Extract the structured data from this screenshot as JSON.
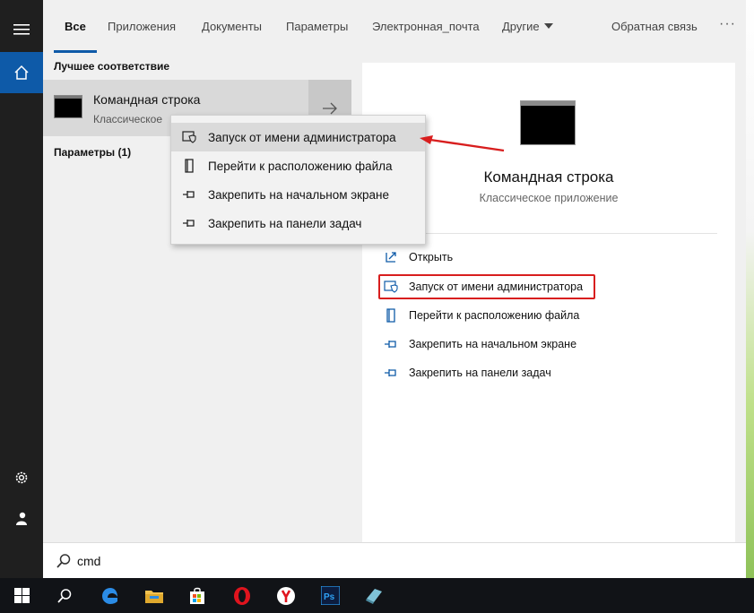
{
  "tabs": [
    {
      "label": "Все"
    },
    {
      "label": "Приложения"
    },
    {
      "label": "Документы"
    },
    {
      "label": "Параметры"
    },
    {
      "label": "Электронная_почта"
    },
    {
      "label": "Другие"
    }
  ],
  "feedback_label": "Обратная связь",
  "more_label": "···",
  "results": {
    "best_match_heading": "Лучшее соответствие",
    "best_title": "Командная строка",
    "best_subtitle": "Классическое",
    "settings_heading": "Параметры (1)"
  },
  "context_menu": [
    {
      "label": "Запуск от имени администратора",
      "icon": "shield-icon"
    },
    {
      "label": "Перейти к расположению файла",
      "icon": "file-location-icon"
    },
    {
      "label": "Закрепить на начальном экране",
      "icon": "pin-icon"
    },
    {
      "label": "Закрепить на панели задач",
      "icon": "pin-icon"
    }
  ],
  "preview": {
    "title": "Командная строка",
    "subtitle": "Классическое приложение",
    "actions": [
      {
        "label": "Открыть",
        "icon": "open-icon"
      },
      {
        "label": "Запуск от имени администратора",
        "icon": "shield-icon"
      },
      {
        "label": "Перейти к расположению файла",
        "icon": "file-location-icon"
      },
      {
        "label": "Закрепить на начальном экране",
        "icon": "pin-icon"
      },
      {
        "label": "Закрепить на панели задач",
        "icon": "pin-icon"
      }
    ]
  },
  "search": {
    "value": "cmd"
  },
  "colors": {
    "accent": "#0e5aa8",
    "annotation": "#d81e1e"
  },
  "taskbar_icons": [
    "windows-start-icon",
    "search-icon",
    "edge-icon",
    "file-explorer-icon",
    "store-icon",
    "opera-icon",
    "yandex-icon",
    "photoshop-icon",
    "app-icon"
  ]
}
